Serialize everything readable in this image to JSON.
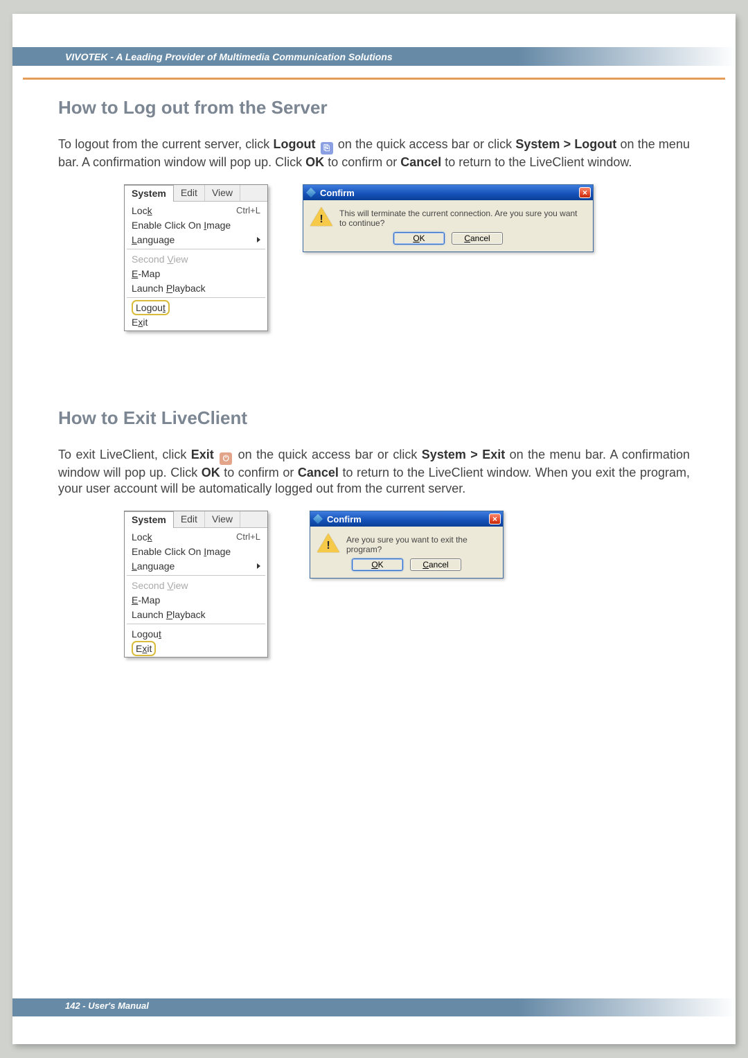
{
  "header": {
    "text": "VIVOTEK - A Leading Provider of Multimedia Communication Solutions"
  },
  "footer": {
    "text": "142 - User's Manual"
  },
  "section_logout": {
    "title": "How to Log out from the Server",
    "para_pre": "To logout from the current server, click ",
    "para_bold1": "Logout",
    "para_mid1": " on the quick access bar or click ",
    "para_bold2": "System > Logout",
    "para_mid2": " on the menu bar. A confirmation window will pop up. Click ",
    "para_bold3": "OK",
    "para_mid3": " to confirm or ",
    "para_bold4": "Cancel",
    "para_end": " to return to the LiveClient window."
  },
  "section_exit": {
    "title": "How to Exit LiveClient",
    "para_pre": "To exit LiveClient, click ",
    "para_bold1": "Exit",
    "para_mid1": " on the quick access bar or click ",
    "para_bold2": "System > Exit",
    "para_mid2": " on the menu bar. A confirmation window will pop up. Click ",
    "para_bold3": "OK",
    "para_mid3": " to confirm or ",
    "para_bold4": "Cancel",
    "para_end": " to return to the LiveClient window. When you exit the program, your user account will be automatically logged out from the current server."
  },
  "menu": {
    "tabs": {
      "system": "System",
      "edit": "Edit",
      "view": "View"
    },
    "items": {
      "lock": "Lock",
      "lock_shortcut": "Ctrl+L",
      "enable_click": "Enable Click On Image",
      "language": "Language",
      "second_view": "Second View",
      "emap": "E-Map",
      "launch_playback": "Launch Playback",
      "logout": "Logout",
      "exit": "Exit"
    }
  },
  "dialog_logout": {
    "title": "Confirm",
    "message": "This will terminate the current connection. Are you sure you want to continue?",
    "ok": "OK",
    "cancel": "Cancel"
  },
  "dialog_exit": {
    "title": "Confirm",
    "message": "Are you sure you want to exit the program?",
    "ok": "OK",
    "cancel": "Cancel"
  }
}
